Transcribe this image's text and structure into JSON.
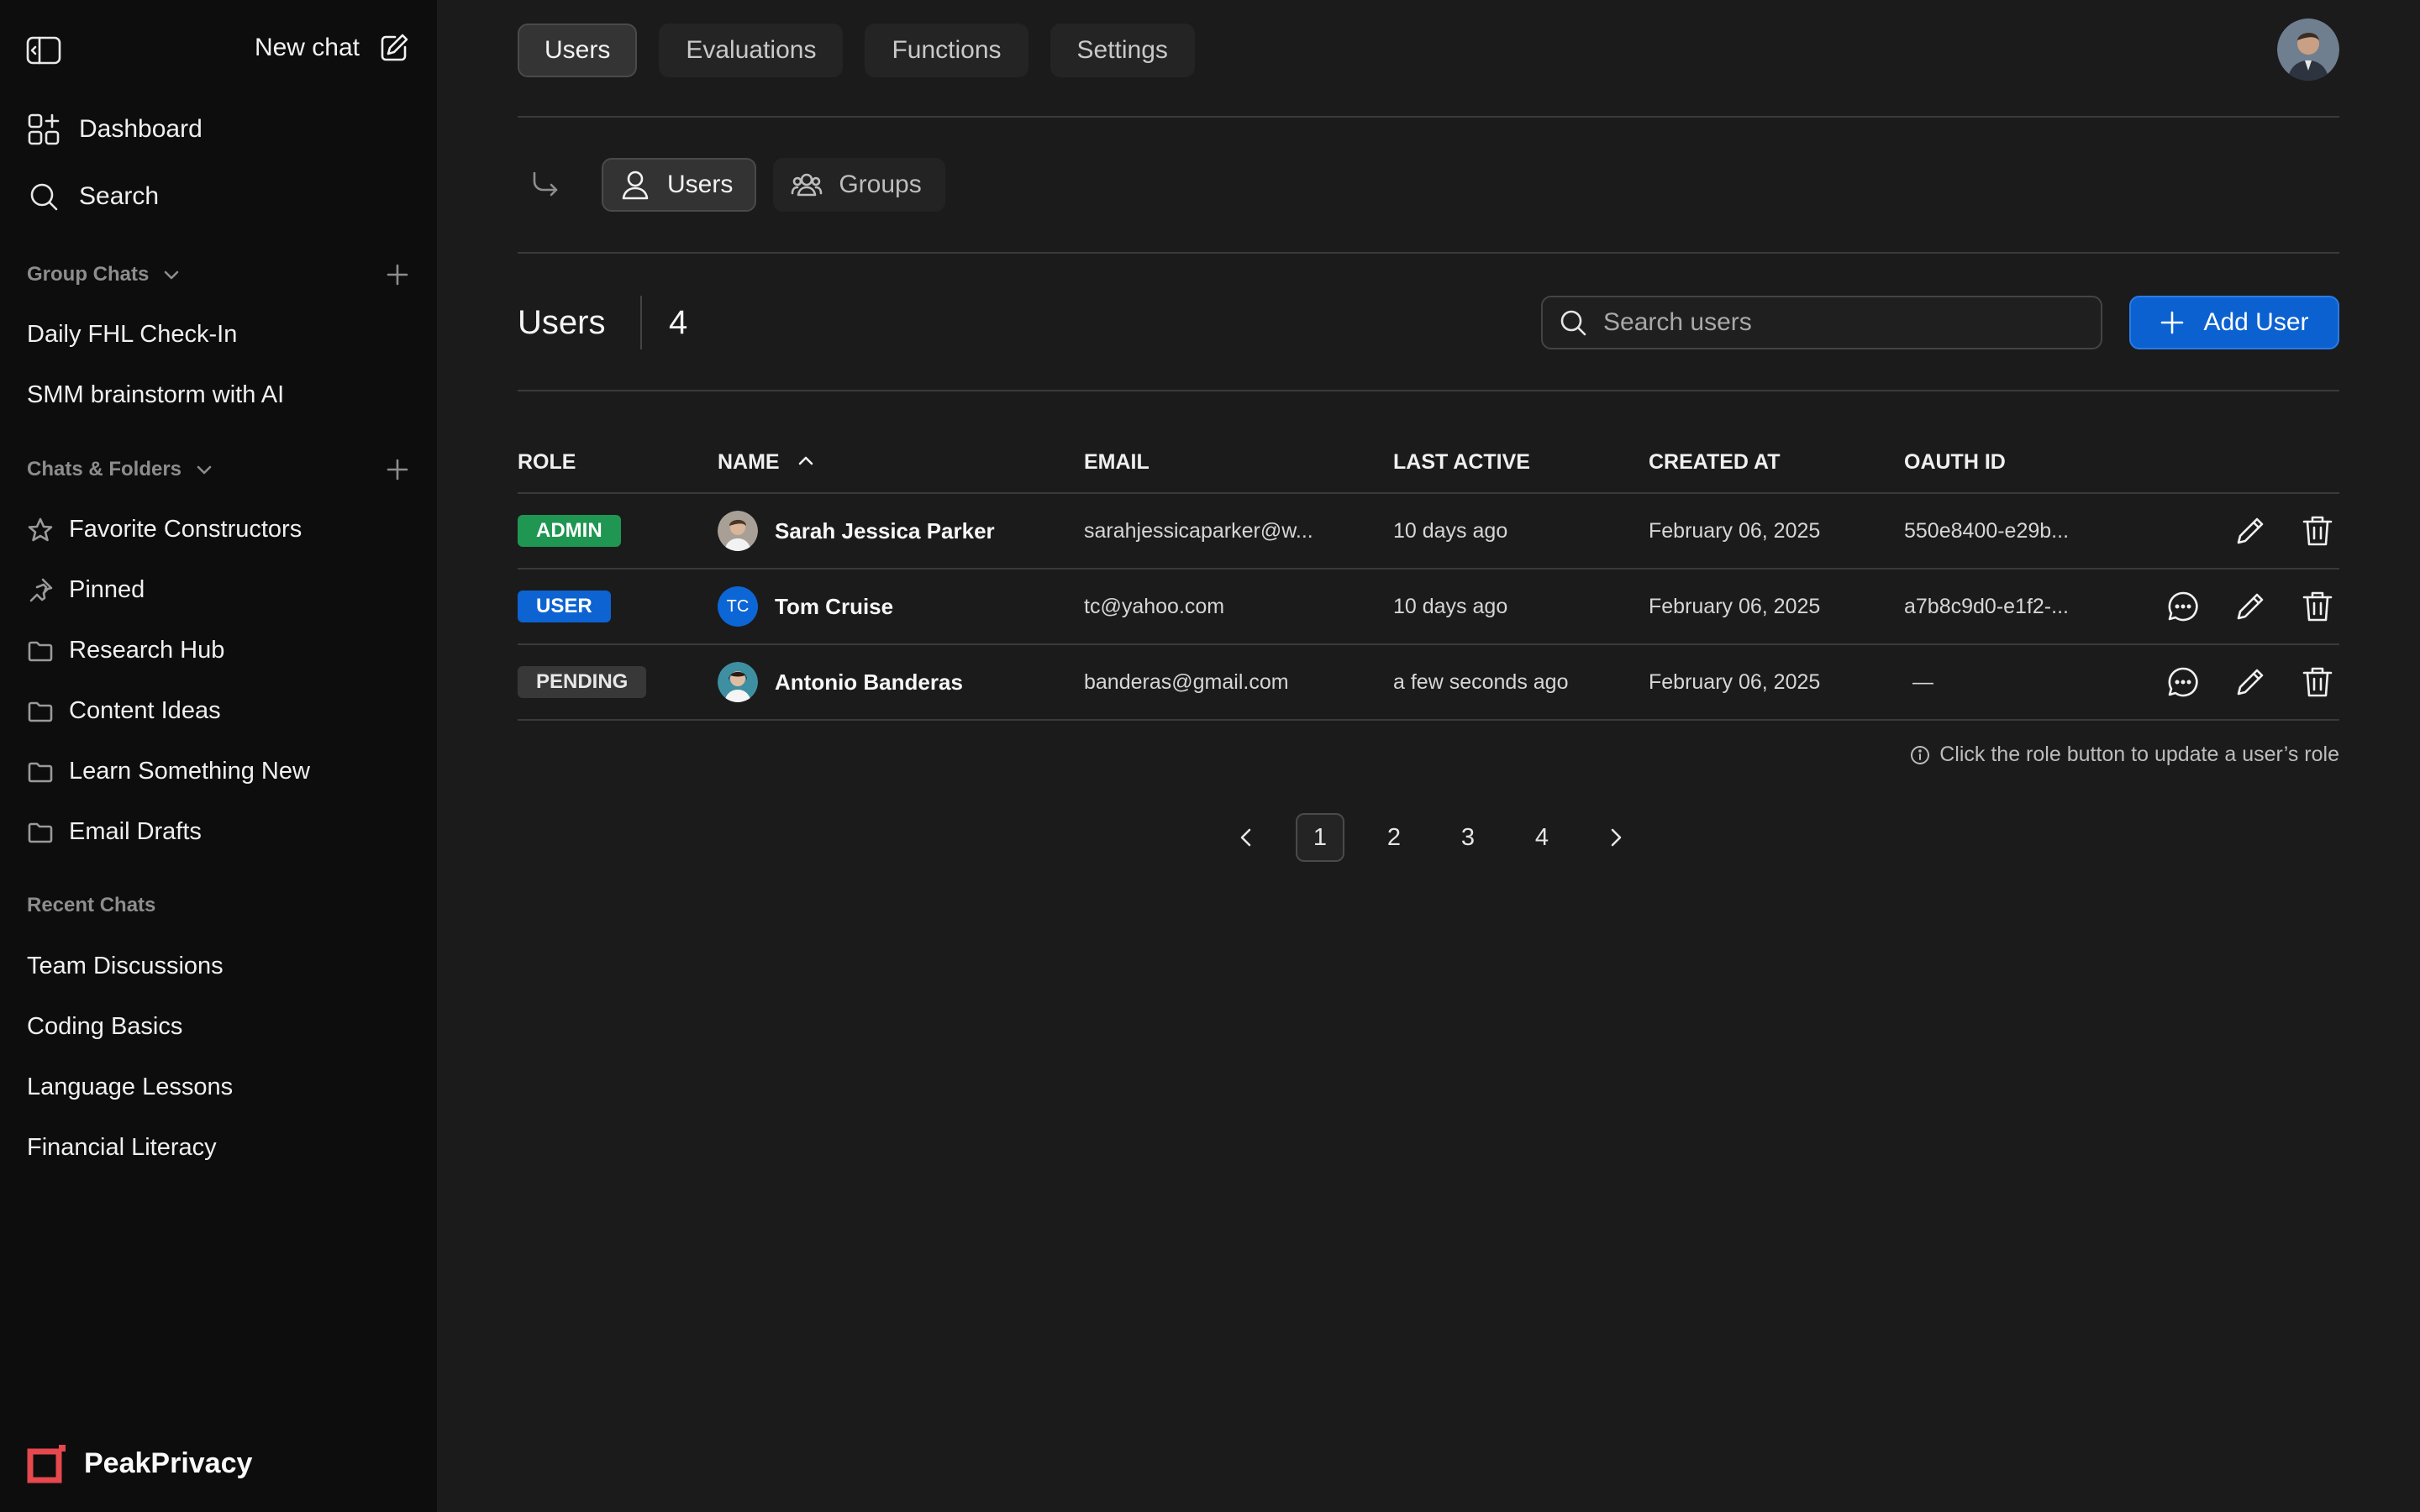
{
  "sidebar": {
    "new_chat": "New chat",
    "nav": [
      {
        "label": "Dashboard",
        "icon": "dashboard-icon"
      },
      {
        "label": "Search",
        "icon": "search-icon"
      }
    ],
    "group_chats": {
      "title": "Group Chats",
      "items": [
        "Daily FHL Check-In",
        "SMM brainstorm with AI"
      ]
    },
    "chats_folders": {
      "title": "Chats & Folders",
      "items": [
        {
          "label": "Favorite Constructors",
          "icon": "star-icon"
        },
        {
          "label": "Pinned",
          "icon": "pin-icon"
        },
        {
          "label": "Research Hub",
          "icon": "folder-icon"
        },
        {
          "label": "Content Ideas",
          "icon": "folder-icon"
        },
        {
          "label": "Learn Something New",
          "icon": "folder-icon"
        },
        {
          "label": "Email Drafts",
          "icon": "folder-icon"
        }
      ]
    },
    "recent": {
      "title": "Recent Chats",
      "items": [
        "Team Discussions",
        "Coding Basics",
        "Language Lessons",
        "Financial Literacy"
      ]
    },
    "brand": "PeakPrivacy",
    "brand_color": "#e5484d"
  },
  "tabs": [
    {
      "label": "Users",
      "active": true
    },
    {
      "label": "Evaluations",
      "active": false
    },
    {
      "label": "Functions",
      "active": false
    },
    {
      "label": "Settings",
      "active": false
    }
  ],
  "subtabs": [
    {
      "label": "Users",
      "active": true
    },
    {
      "label": "Groups",
      "active": false
    }
  ],
  "users_header": {
    "title": "Users",
    "count": "4",
    "search_placeholder": "Search users",
    "add_label": "Add User"
  },
  "table": {
    "columns": [
      "ROLE",
      "NAME",
      "EMAIL",
      "LAST ACTIVE",
      "CREATED AT",
      "OAUTH ID"
    ],
    "sorted_by": "NAME",
    "rows": [
      {
        "role": "ADMIN",
        "name": "Sarah Jessica Parker",
        "initials": "",
        "email": "sarahjessicaparker@w...",
        "last_active": "10 days ago",
        "created_at": "February 06, 2025",
        "oauth_id": "550e8400-e29b...",
        "chat_action": false
      },
      {
        "role": "USER",
        "name": "Tom Cruise",
        "initials": "TC",
        "email": "tc@yahoo.com",
        "last_active": "10 days ago",
        "created_at": "February 06, 2025",
        "oauth_id": "a7b8c9d0-e1f2-...",
        "chat_action": true
      },
      {
        "role": "PENDING",
        "name": "Antonio Banderas",
        "initials": "",
        "email": "banderas@gmail.com",
        "last_active": "a few seconds ago",
        "created_at": "February 06, 2025",
        "oauth_id": "—",
        "chat_action": true
      }
    ]
  },
  "hint": "Click the role button to update a user’s role",
  "pagination": {
    "pages": [
      "1",
      "2",
      "3",
      "4"
    ],
    "current": "1"
  },
  "colors": {
    "admin": "#1f9652",
    "user": "#0c63d1",
    "pending": "#383838",
    "accent": "#0b61d0"
  }
}
